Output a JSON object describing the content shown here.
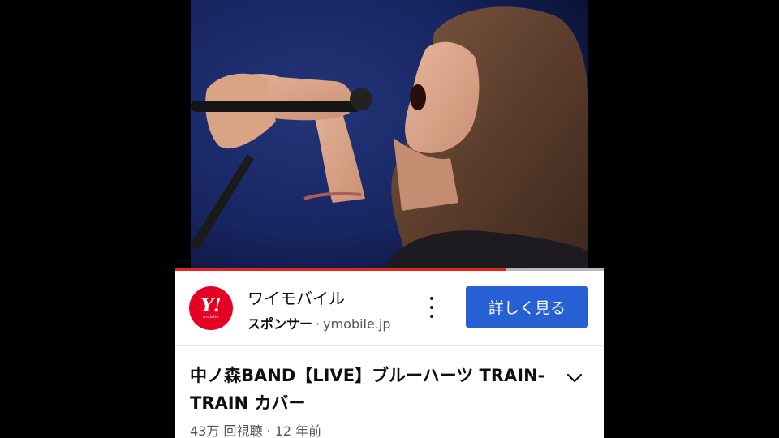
{
  "video": {
    "progress_percent": 77
  },
  "ad": {
    "logo_text": "Y!",
    "logo_subtext": "mobile",
    "advertiser": "ワイモバイル",
    "sponsor_label": "スポンサー",
    "separator": "·",
    "domain": "ymobile.jp",
    "cta_label": "詳しく見る",
    "brand_color": "#e60023",
    "cta_color": "#2760d4"
  },
  "details": {
    "title": "中ノ森BAND【LIVE】ブルーハーツ TRAIN-TRAIN カバー",
    "views": "43万 回視聴",
    "separator": "·",
    "age": "12 年前"
  },
  "icons": {
    "more": "kebab-menu-icon",
    "expand": "chevron-down-icon"
  }
}
